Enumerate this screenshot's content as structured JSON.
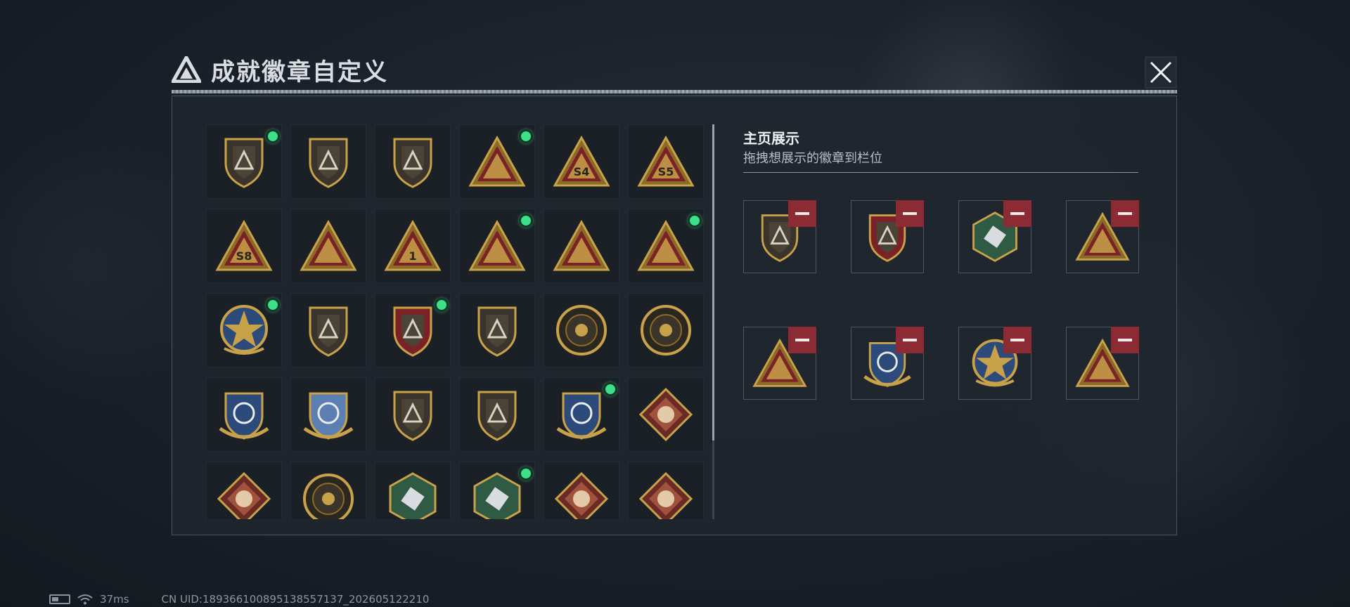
{
  "header": {
    "title": "成就徽章自定义"
  },
  "showcase": {
    "title": "主页展示",
    "subtitle": "拖拽想展示的徽章到栏位"
  },
  "colors": {
    "panel_bg": "#20262e",
    "active_dot": "#3be08a",
    "remove_button": "#8c2b33",
    "gold": "#c8a24a"
  },
  "badges": [
    {
      "icon": "triangle-logo-shield-badge-icon",
      "active": true
    },
    {
      "icon": "helicopter-shield-badge-icon",
      "active": false
    },
    {
      "icon": "dagger-shield-badge-icon",
      "active": false
    },
    {
      "icon": "radar-triangle-badge-icon",
      "active": true
    },
    {
      "icon": "s4-triangle-badge-icon",
      "active": false
    },
    {
      "icon": "s5-triangle-badge-icon",
      "active": false
    },
    {
      "icon": "s8-triangle-badge-icon",
      "active": false
    },
    {
      "icon": "boat-triangle-badge-icon",
      "active": false
    },
    {
      "icon": "number-one-triangle-badge-icon",
      "active": false
    },
    {
      "icon": "soldiers-triangle-badge-icon",
      "active": true
    },
    {
      "icon": "squad-triangle-badge-icon",
      "active": false
    },
    {
      "icon": "rocket-triangle-badge-icon",
      "active": true
    },
    {
      "icon": "star-medal-badge-icon",
      "active": true
    },
    {
      "icon": "chevron-shield-badge-icon",
      "active": false
    },
    {
      "icon": "winged-shield-badge-icon",
      "active": true
    },
    {
      "icon": "dice-shield-badge-icon",
      "active": false
    },
    {
      "icon": "skull-crosshair-badge-icon",
      "active": false
    },
    {
      "icon": "beast-round-badge-icon",
      "active": false
    },
    {
      "icon": "sniper-crest-badge-icon",
      "active": false
    },
    {
      "icon": "blue-crosshair-crest-badge-icon",
      "active": false
    },
    {
      "icon": "rifle-shield-badge-icon",
      "active": false
    },
    {
      "icon": "pistol-shield-badge-icon",
      "active": false
    },
    {
      "icon": "rocket-crest-badge-icon",
      "active": true
    },
    {
      "icon": "wolf-diamond-badge-icon",
      "active": false
    },
    {
      "icon": "wolf-diamond-badge-icon",
      "active": false
    },
    {
      "icon": "eagle-round-badge-icon",
      "active": false
    },
    {
      "icon": "dragon-hexagon-badge-icon",
      "active": false
    },
    {
      "icon": "gun-hexagon-badge-icon",
      "active": true
    },
    {
      "icon": "dragon-diamond-badge-icon",
      "active": false
    },
    {
      "icon": "dragon-diamond-badge-icon",
      "active": false
    }
  ],
  "slots": [
    {
      "icon": "triangle-logo-shield-badge-icon"
    },
    {
      "icon": "winged-shield-badge-icon"
    },
    {
      "icon": "gun-hexagon-badge-icon"
    },
    {
      "icon": "rocket-triangle-badge-icon"
    },
    {
      "icon": "radar-triangle-badge-icon"
    },
    {
      "icon": "rocket-crest-badge-icon"
    },
    {
      "icon": "star-medal-badge-icon"
    },
    {
      "icon": "soldiers-triangle-badge-icon"
    }
  ],
  "footer": {
    "ping": "37ms",
    "uid": "CN UID:1893661008951385571​37_202605122210"
  }
}
